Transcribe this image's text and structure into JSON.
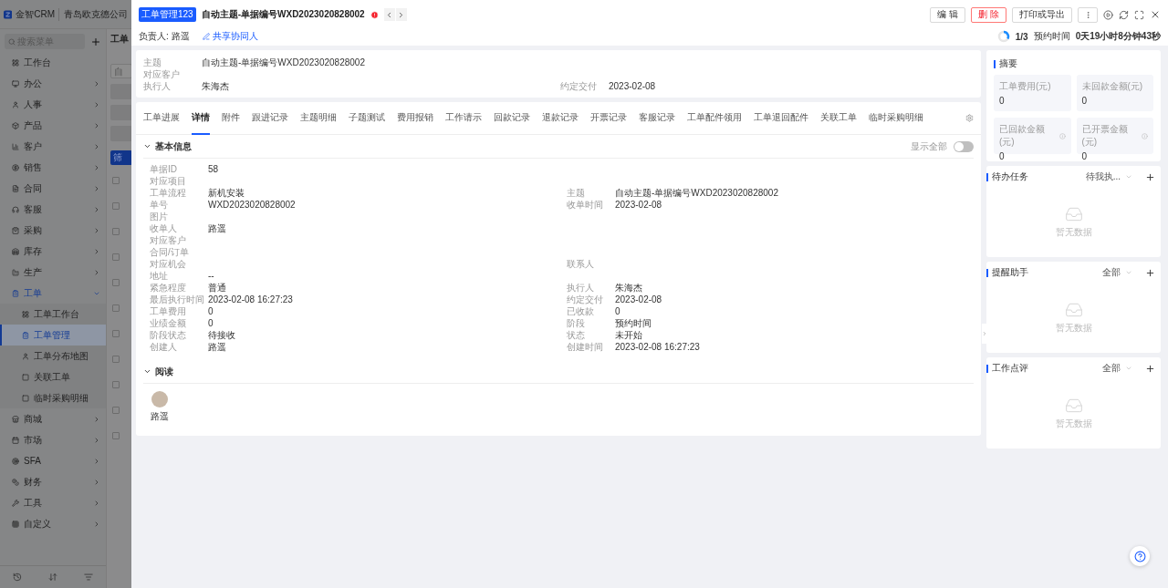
{
  "sidebar": {
    "logo": "金智CRM",
    "company": "青岛欧克德公司",
    "search": {
      "placeholder": "搜索菜单"
    },
    "items": [
      {
        "label": "工作台",
        "kind": "link",
        "selected": false
      },
      {
        "label": "办公",
        "kind": "group",
        "expanded": false,
        "selected": false
      },
      {
        "label": "人事",
        "kind": "group",
        "expanded": false,
        "selected": false
      },
      {
        "label": "产品",
        "kind": "group",
        "expanded": false,
        "selected": false
      },
      {
        "label": "客户",
        "kind": "group",
        "expanded": false,
        "selected": false
      },
      {
        "label": "销售",
        "kind": "group",
        "expanded": false,
        "selected": false
      },
      {
        "label": "合同",
        "kind": "group",
        "expanded": false,
        "selected": false
      },
      {
        "label": "客服",
        "kind": "group",
        "expanded": false,
        "selected": false
      },
      {
        "label": "采购",
        "kind": "group",
        "expanded": false,
        "selected": false
      },
      {
        "label": "库存",
        "kind": "group",
        "expanded": false,
        "selected": false
      },
      {
        "label": "生产",
        "kind": "group",
        "expanded": false,
        "selected": false
      },
      {
        "label": "工单",
        "kind": "group",
        "expanded": true,
        "selected": true,
        "children": [
          {
            "label": "工单工作台",
            "selected": false
          },
          {
            "label": "工单管理",
            "selected": true
          },
          {
            "label": "工单分布地图",
            "selected": false
          },
          {
            "label": "关联工单",
            "selected": false
          },
          {
            "label": "临时采购明细",
            "selected": false
          }
        ]
      },
      {
        "label": "商城",
        "kind": "group",
        "expanded": false,
        "selected": false
      },
      {
        "label": "市场",
        "kind": "group",
        "expanded": false,
        "selected": false
      },
      {
        "label": "SFA",
        "kind": "group",
        "expanded": false,
        "selected": false
      },
      {
        "label": "财务",
        "kind": "group",
        "expanded": false,
        "selected": false
      },
      {
        "label": "工具",
        "kind": "group",
        "expanded": false,
        "selected": false
      },
      {
        "label": "自定义",
        "kind": "group",
        "expanded": false,
        "selected": false
      }
    ]
  },
  "background_page": {
    "title": "工单",
    "field": {
      "placeholder": "自"
    },
    "button": "筛",
    "rows": [
      {
        "checked": false
      },
      {
        "checked": false
      },
      {
        "checked": false
      },
      {
        "checked": false
      },
      {
        "checked": false
      },
      {
        "checked": false
      },
      {
        "checked": false
      },
      {
        "checked": false
      },
      {
        "checked": false
      },
      {
        "checked": false
      },
      {
        "checked": false
      }
    ]
  },
  "drawer": {
    "header": {
      "tag": "工单管理123",
      "title": "自动主题-单据编号WXD2023020828002",
      "actions": [
        {
          "label": "编 辑",
          "kind": "default"
        },
        {
          "label": "删 除",
          "kind": "danger"
        },
        {
          "label": "打印或导出",
          "kind": "default"
        }
      ],
      "owner": "负责人: 路遥",
      "share_link": "共享协同人",
      "progress": {
        "count": "1/3",
        "label": "预约时间",
        "remaining": "0天19小时8分钟43秒"
      }
    },
    "summary_fields": [
      {
        "left": {
          "label": "主题",
          "value": "自动主题-单据编号WXD2023020828002"
        }
      },
      {
        "left": {
          "label": "对应客户"
        }
      },
      {
        "left": {
          "label": "执行人",
          "value": "朱海杰"
        },
        "right": {
          "label": "约定交付",
          "value": "2023-02-08"
        }
      }
    ],
    "tabs": [
      {
        "label": "工单进展",
        "selected": false
      },
      {
        "label": "详情",
        "selected": true
      },
      {
        "label": "附件",
        "selected": false
      },
      {
        "label": "跟进记录",
        "selected": false
      },
      {
        "label": "主题明细",
        "selected": false
      },
      {
        "label": "子题测试",
        "selected": false
      },
      {
        "label": "费用报销",
        "selected": false
      },
      {
        "label": "工作请示",
        "selected": false
      },
      {
        "label": "回款记录",
        "selected": false
      },
      {
        "label": "退款记录",
        "selected": false
      },
      {
        "label": "开票记录",
        "selected": false
      },
      {
        "label": "客服记录",
        "selected": false
      },
      {
        "label": "工单配件领用",
        "selected": false
      },
      {
        "label": "工单退回配件",
        "selected": false
      },
      {
        "label": "关联工单",
        "selected": false
      },
      {
        "label": "临时采购明细",
        "selected": false
      }
    ],
    "basic_info": {
      "title": "基本信息",
      "expanded": true,
      "show_all": {
        "label": "显示全部",
        "on": false
      },
      "rows": [
        {
          "left": {
            "label": "单据ID",
            "value": "58"
          }
        },
        {
          "left": {
            "label": "对应项目"
          }
        },
        {
          "left": {
            "label": "工单流程",
            "value": "新机安装"
          },
          "right": {
            "label": "主题",
            "value": "自动主题-单据编号WXD2023020828002"
          }
        },
        {
          "left": {
            "label": "单号",
            "value": "WXD2023020828002"
          },
          "right": {
            "label": "收单时间",
            "value": "2023-02-08"
          }
        },
        {
          "left": {
            "label": "图片"
          }
        },
        {
          "left": {
            "label": "收单人",
            "value": "路遥"
          }
        },
        {
          "left": {
            "label": "对应客户"
          }
        },
        {
          "left": {
            "label": "合同/订单"
          }
        },
        {
          "left": {
            "label": "对应机会"
          },
          "right": {
            "label": "联系人"
          }
        },
        {
          "left": {
            "label": "地址",
            "value": "--"
          }
        },
        {
          "left": {
            "label": "紧急程度",
            "value": "普通"
          },
          "right": {
            "label": "执行人",
            "value": "朱海杰"
          }
        },
        {
          "left": {
            "label": "最后执行时间",
            "value": "2023-02-08 16:27:23"
          },
          "right": {
            "label": "约定交付",
            "value": "2023-02-08"
          }
        },
        {
          "left": {
            "label": "工单费用",
            "value": "0"
          },
          "right": {
            "label": "已收款",
            "value": "0"
          }
        },
        {
          "left": {
            "label": "业绩金额",
            "value": "0"
          },
          "right": {
            "label": "阶段",
            "value": "预约时间"
          }
        },
        {
          "left": {
            "label": "阶段状态",
            "value": "待接收"
          },
          "right": {
            "label": "状态",
            "value": "未开始"
          }
        },
        {
          "left": {
            "label": "创建人",
            "value": "路遥"
          },
          "right": {
            "label": "创建时间",
            "value": "2023-02-08 16:27:23"
          }
        }
      ]
    },
    "read_section": {
      "title": "阅读",
      "expanded": true,
      "readers": [
        {
          "name": "路遥"
        }
      ]
    },
    "summary": {
      "title": "摘要",
      "stats": [
        {
          "label": "工单费用(元)",
          "value": "0",
          "info": false
        },
        {
          "label": "未回款金额(元)",
          "value": "0",
          "info": false
        },
        {
          "label": "已回款金额(元)",
          "value": "0",
          "info": true
        },
        {
          "label": "已开票金额(元)",
          "value": "0",
          "info": true
        }
      ]
    },
    "panels": [
      {
        "title": "待办任务",
        "filter": "待我执...",
        "empty": "暂无数据"
      },
      {
        "title": "提醒助手",
        "filter": "全部",
        "empty": "暂无数据"
      },
      {
        "title": "工作点评",
        "filter": "全部",
        "empty": "暂无数据"
      }
    ]
  }
}
